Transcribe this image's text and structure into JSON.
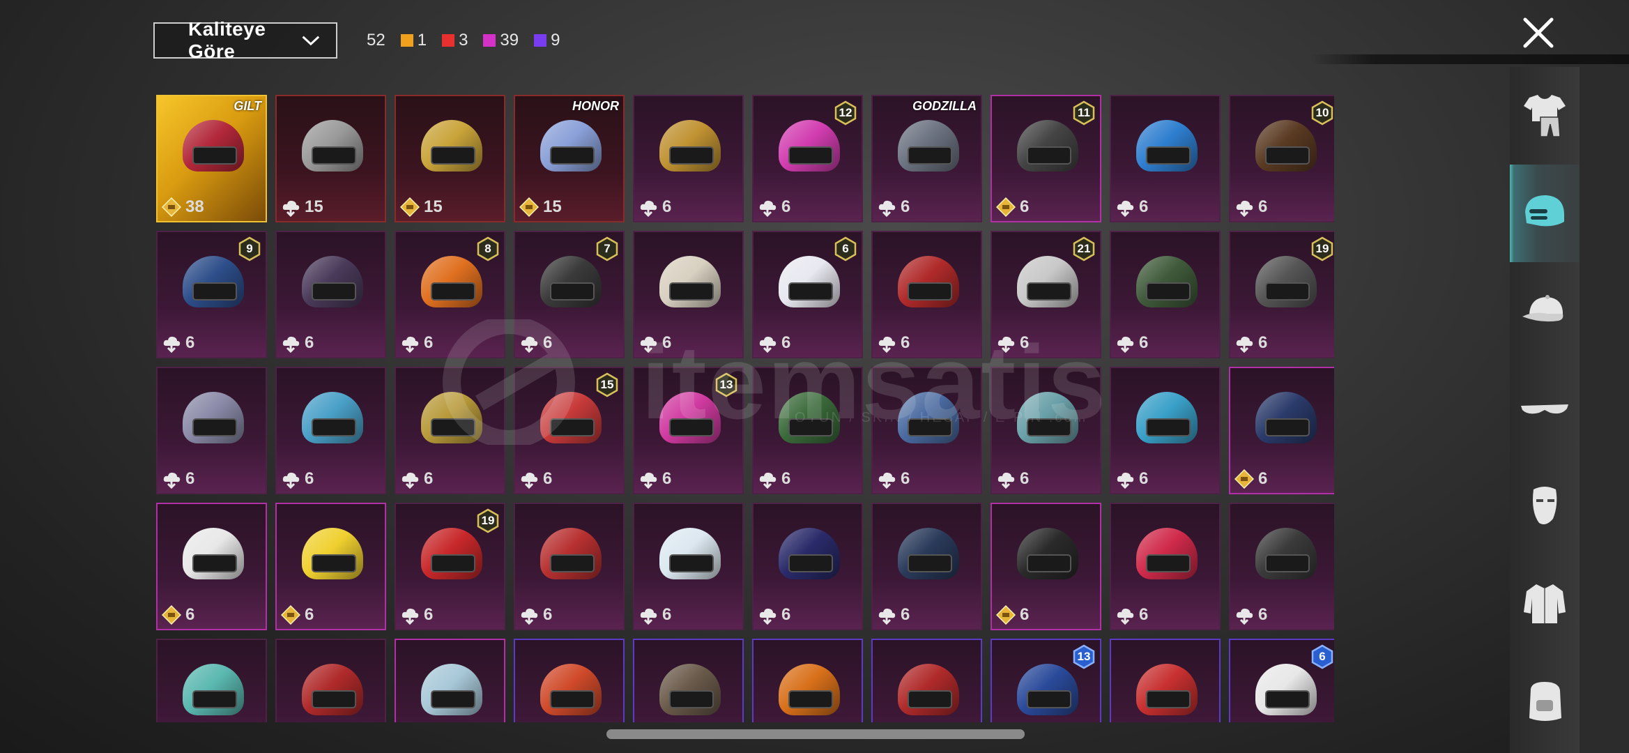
{
  "toolbar": {
    "sort_label": "Kaliteye Göre",
    "total_count": "52",
    "quality_counts": [
      {
        "color": "#f0a01c",
        "count": "1"
      },
      {
        "color": "#e8302e",
        "count": "3"
      },
      {
        "color": "#d431c8",
        "count": "39"
      },
      {
        "color": "#7a3cf0",
        "count": "9"
      }
    ]
  },
  "sidebar": {
    "items": [
      {
        "icon": "outfit-icon"
      },
      {
        "icon": "helmet-icon",
        "active": true
      },
      {
        "icon": "cap-icon"
      },
      {
        "icon": "glasses-icon"
      },
      {
        "icon": "mask-icon"
      },
      {
        "icon": "jacket-icon"
      },
      {
        "icon": "backpack-icon"
      }
    ]
  },
  "watermark": {
    "text": "itemsatis",
    "sub": "OYUN / SKIN / HESAP / E-PIN .com"
  },
  "items": [
    {
      "rarity": "gold",
      "color": "#b2283a",
      "cost": "38",
      "currency": "gold",
      "brand": "GILT"
    },
    {
      "rarity": "red",
      "color": "#9a9a9a",
      "cost": "15",
      "currency": "cloud"
    },
    {
      "rarity": "red",
      "color": "#c9a43a",
      "cost": "15",
      "currency": "gold"
    },
    {
      "rarity": "red",
      "color": "#8aa0d8",
      "cost": "15",
      "currency": "gold",
      "brand": "HONOR"
    },
    {
      "rarity": "pink",
      "color": "#c09232",
      "cost": "6",
      "currency": "cloud"
    },
    {
      "rarity": "pink",
      "color": "#d23db0",
      "cost": "6",
      "currency": "cloud",
      "badge": "12"
    },
    {
      "rarity": "pink",
      "color": "#6b7280",
      "cost": "6",
      "currency": "cloud",
      "brand": "GODZILLA"
    },
    {
      "rarity": "pinkb",
      "color": "#444444",
      "cost": "6",
      "currency": "gold",
      "badge": "11"
    },
    {
      "rarity": "pink",
      "color": "#2f7fd0",
      "cost": "6",
      "currency": "cloud"
    },
    {
      "rarity": "pink",
      "color": "#5a3a22",
      "cost": "6",
      "currency": "cloud",
      "badge": "10"
    },
    {
      "rarity": "pink",
      "color": "#2d4e8a",
      "cost": "6",
      "currency": "cloud",
      "badge": "9"
    },
    {
      "rarity": "pink",
      "color": "#4a3a5a",
      "cost": "6",
      "currency": "cloud"
    },
    {
      "rarity": "pink",
      "color": "#e07020",
      "cost": "6",
      "currency": "cloud",
      "badge": "8"
    },
    {
      "rarity": "pink",
      "color": "#3a3a3a",
      "cost": "6",
      "currency": "cloud",
      "badge": "7"
    },
    {
      "rarity": "pink",
      "color": "#d8d0c0",
      "cost": "6",
      "currency": "cloud"
    },
    {
      "rarity": "pink",
      "color": "#e8e8f0",
      "cost": "6",
      "currency": "cloud",
      "badge": "6"
    },
    {
      "rarity": "pink",
      "color": "#b02a2a",
      "cost": "6",
      "currency": "cloud"
    },
    {
      "rarity": "pink",
      "color": "#c8c8c8",
      "cost": "6",
      "currency": "cloud",
      "badge": "21"
    },
    {
      "rarity": "pink",
      "color": "#3f5a3a",
      "cost": "6",
      "currency": "cloud"
    },
    {
      "rarity": "pink",
      "color": "#555555",
      "cost": "6",
      "currency": "cloud",
      "badge": "19"
    },
    {
      "rarity": "pink",
      "color": "#8a8aa8",
      "cost": "6",
      "currency": "cloud"
    },
    {
      "rarity": "pink",
      "color": "#4aa0c8",
      "cost": "6",
      "currency": "cloud"
    },
    {
      "rarity": "pink",
      "color": "#b89a3a",
      "cost": "6",
      "currency": "cloud"
    },
    {
      "rarity": "pink",
      "color": "#c83a3a",
      "cost": "6",
      "currency": "cloud",
      "badge": "15"
    },
    {
      "rarity": "pink",
      "color": "#d03aa0",
      "cost": "6",
      "currency": "cloud",
      "badge": "13"
    },
    {
      "rarity": "pink",
      "color": "#3a6a3a",
      "cost": "6",
      "currency": "cloud"
    },
    {
      "rarity": "pink",
      "color": "#4a6aa0",
      "cost": "6",
      "currency": "cloud"
    },
    {
      "rarity": "pink",
      "color": "#6aa0a8",
      "cost": "6",
      "currency": "cloud"
    },
    {
      "rarity": "pink",
      "color": "#3aa0c8",
      "cost": "6",
      "currency": "cloud"
    },
    {
      "rarity": "pinkb",
      "color": "#2a3a6a",
      "cost": "6",
      "currency": "gold"
    },
    {
      "rarity": "pinkb",
      "color": "#e8e8e8",
      "cost": "6",
      "currency": "gold"
    },
    {
      "rarity": "pinkb",
      "color": "#f0d030",
      "cost": "6",
      "currency": "gold"
    },
    {
      "rarity": "pink",
      "color": "#c8282a",
      "cost": "6",
      "currency": "cloud",
      "badge": "19"
    },
    {
      "rarity": "pink",
      "color": "#b83030",
      "cost": "6",
      "currency": "cloud"
    },
    {
      "rarity": "pink",
      "color": "#dce8f0",
      "cost": "6",
      "currency": "cloud"
    },
    {
      "rarity": "pink",
      "color": "#2a2a6a",
      "cost": "6",
      "currency": "cloud"
    },
    {
      "rarity": "pink",
      "color": "#2a3a5a",
      "cost": "6",
      "currency": "cloud"
    },
    {
      "rarity": "pinkb",
      "color": "#2a2a2a",
      "cost": "6",
      "currency": "gold"
    },
    {
      "rarity": "pink",
      "color": "#d02a4a",
      "cost": "6",
      "currency": "cloud"
    },
    {
      "rarity": "pink",
      "color": "#3a3a3a",
      "cost": "6",
      "currency": "cloud"
    },
    {
      "rarity": "pink",
      "color": "#5ab8b0",
      "currency": "none"
    },
    {
      "rarity": "pink",
      "color": "#b02a2a",
      "currency": "none"
    },
    {
      "rarity": "pinkb",
      "color": "#a8c8d8",
      "currency": "none"
    },
    {
      "rarity": "purple",
      "color": "#d04a2a",
      "currency": "none"
    },
    {
      "rarity": "purple",
      "color": "#6a5a4a",
      "currency": "none"
    },
    {
      "rarity": "purple",
      "color": "#d8701a",
      "currency": "none"
    },
    {
      "rarity": "purple",
      "color": "#b02a2a",
      "currency": "none"
    },
    {
      "rarity": "purple",
      "color": "#2a4a9a",
      "currency": "none",
      "badge": "13"
    },
    {
      "rarity": "purple",
      "color": "#c83030",
      "currency": "none"
    },
    {
      "rarity": "purpleb",
      "color": "#e8e8e8",
      "currency": "none",
      "badge": "6"
    }
  ]
}
